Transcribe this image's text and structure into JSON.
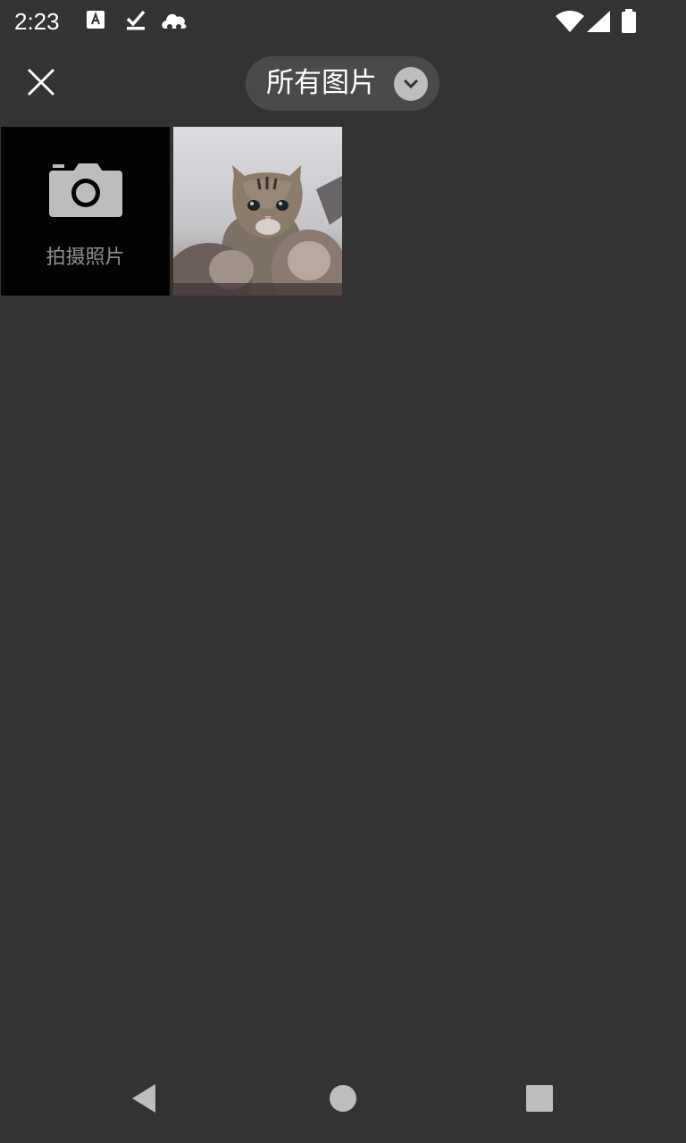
{
  "status_bar": {
    "time": "2:23",
    "left_icons": [
      "keyboard-a-icon",
      "download-done-icon",
      "cloud-icon"
    ],
    "right_icons": [
      "wifi-icon",
      "signal-icon",
      "battery-icon"
    ]
  },
  "toolbar": {
    "close_icon": "close-icon",
    "album_label": "所有图片",
    "album_chevron_icon": "chevron-down-icon"
  },
  "grid": {
    "camera_tile": {
      "icon": "camera-icon",
      "label": "拍摄照片"
    },
    "photos": [
      {
        "subject": "cat-photo"
      }
    ]
  },
  "nav_bar": {
    "icons": [
      "back-icon",
      "home-icon",
      "recents-icon"
    ]
  },
  "colors": {
    "background": "#333333",
    "pill": "#4a4a4a",
    "camera_tile": "#030303",
    "icon_gray": "#bdbdbd",
    "label_gray": "#8f8f8f"
  }
}
